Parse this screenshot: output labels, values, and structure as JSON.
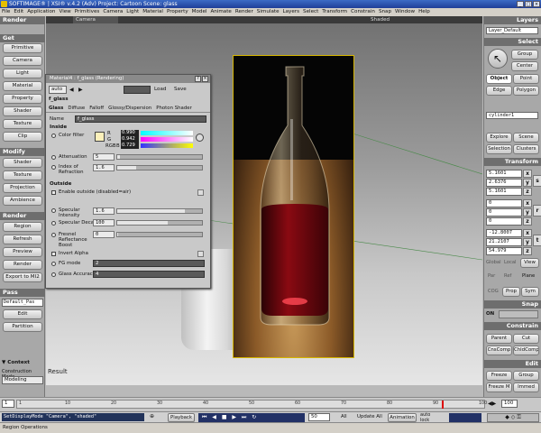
{
  "app": {
    "title": "SOFTIMAGE® | XSI® v.4.2 (Adv) Project: Cartoon   Scene: glass"
  },
  "menu": [
    "File",
    "Edit",
    "Application",
    "View",
    "Primitives",
    "Camera",
    "Light",
    "Material",
    "Property",
    "Model",
    "Animate",
    "Render",
    "Simulate",
    "Layers",
    "Select",
    "Transform",
    "Constrain",
    "Snap",
    "Window",
    "Help"
  ],
  "left": {
    "render_hdr": "Render",
    "get_hdr": "Get",
    "get_items": [
      "Primitive",
      "Camera",
      "Light",
      "Material",
      "Property",
      "Shader",
      "Texture",
      "Clip"
    ],
    "modify_hdr": "Modify",
    "modify_items": [
      "Shader",
      "Texture",
      "Projection",
      "Ambience"
    ],
    "render2_hdr": "Render",
    "render_items": [
      "Region",
      "Refresh",
      "Preview",
      "Render",
      "Export to MI2"
    ],
    "pass_hdr": "Pass",
    "pass_field": "Default_Pas",
    "pass_items": [
      "Edit",
      "Partition"
    ],
    "context": "▼ Context",
    "construction_label": "Construction Mode",
    "construction_value": "Modeling"
  },
  "viewport": {
    "camera": "Camera",
    "shaded": "Shaded",
    "result": "Result"
  },
  "dialog": {
    "title": "Material4 : f_glass (Rendering)",
    "auto": "auto",
    "load": "Load",
    "save": "Save",
    "preset": "f_glass",
    "tabs": [
      "Glass",
      "Diffuse",
      "Falloff",
      "Glossy/Dispersion",
      "Photon Shader"
    ],
    "name_label": "Name",
    "name_value": "f_glass",
    "inside": "Inside",
    "color_filter": "Color filter",
    "r_label": "R",
    "g_label": "G",
    "b_label": "B",
    "rgb_label": "RGB",
    "r": "0.990",
    "g": "0.942",
    "b": "0.729",
    "attenuation": "Attenuation",
    "attenuation_val": "5",
    "ior": "Index of Refraction",
    "ior_val": "1.6",
    "outside": "Outside",
    "enable_outside": "Enable outside (disabled=air)",
    "spec_int": "Specular Intensity",
    "spec_int_val": "1.6",
    "spec_decay": "Specular Decay",
    "spec_decay_val": "100",
    "fresnel": "Fresnel Reflectance Boost",
    "fresnel_val": "0",
    "invert_alpha": "Invert Alpha",
    "fg_mode": "FG mode",
    "fg_mode_val": "2",
    "glass_acc": "Glass Accuracy",
    "glass_acc_val": "4"
  },
  "right": {
    "layers_hdr": "Layers",
    "layer_default": "Layer_Default",
    "select_hdr": "Select",
    "group": "Group",
    "center": "Center",
    "object": "Object",
    "point": "Point",
    "edge": "Edge",
    "polygon": "Polygon",
    "selection_field": "cylinder1",
    "explore": "Explore",
    "scene": "Scene",
    "selection": "Selection",
    "clusters": "Clusters",
    "transform_hdr": "Transform",
    "scale_vals": [
      "5.1601",
      "2.6376",
      "5.1601"
    ],
    "rot_vals": [
      "0",
      "0",
      "0"
    ],
    "trans_vals": [
      "-12.8007",
      "21.2107",
      "54.979"
    ],
    "scale_lbl": "s",
    "rot_lbl": "r",
    "trans_lbl": "t",
    "x": "x",
    "y": "y",
    "z": "z",
    "global": "Global",
    "local": "Local",
    "view": "View",
    "par": "Par",
    "ref": "Ref",
    "plane": "Plane",
    "cog": "COG",
    "prop": "Prop",
    "sym": "Sym",
    "snap_hdr": "Snap",
    "snap_on": "ON",
    "constrain_hdr": "Constrain",
    "parent": "Parent",
    "cut": "Cut",
    "cnscomp": "CnsComp",
    "chldcomp": "ChldComp",
    "edit_hdr": "Edit",
    "freeze": "Freeze",
    "group2": "Group",
    "freeze_m": "Freeze M",
    "immed": "Immed"
  },
  "timeline": {
    "start": "1",
    "end": "100",
    "ticks": [
      "1",
      "10",
      "20",
      "30",
      "40",
      "50",
      "60",
      "70",
      "80",
      "90",
      "100"
    ]
  },
  "cmd": {
    "text": "SetDisplayMode \"Camera\", \"shaded\"",
    "playback": "Playback",
    "frame": "50",
    "all": "All",
    "update_all": "Update All",
    "animation": "Animation",
    "auto": "auto",
    "lock": "lock"
  },
  "status": {
    "text": "Region Operations"
  },
  "colors": {
    "accent": "#d6b600",
    "titlebar": "#1f3f98"
  }
}
